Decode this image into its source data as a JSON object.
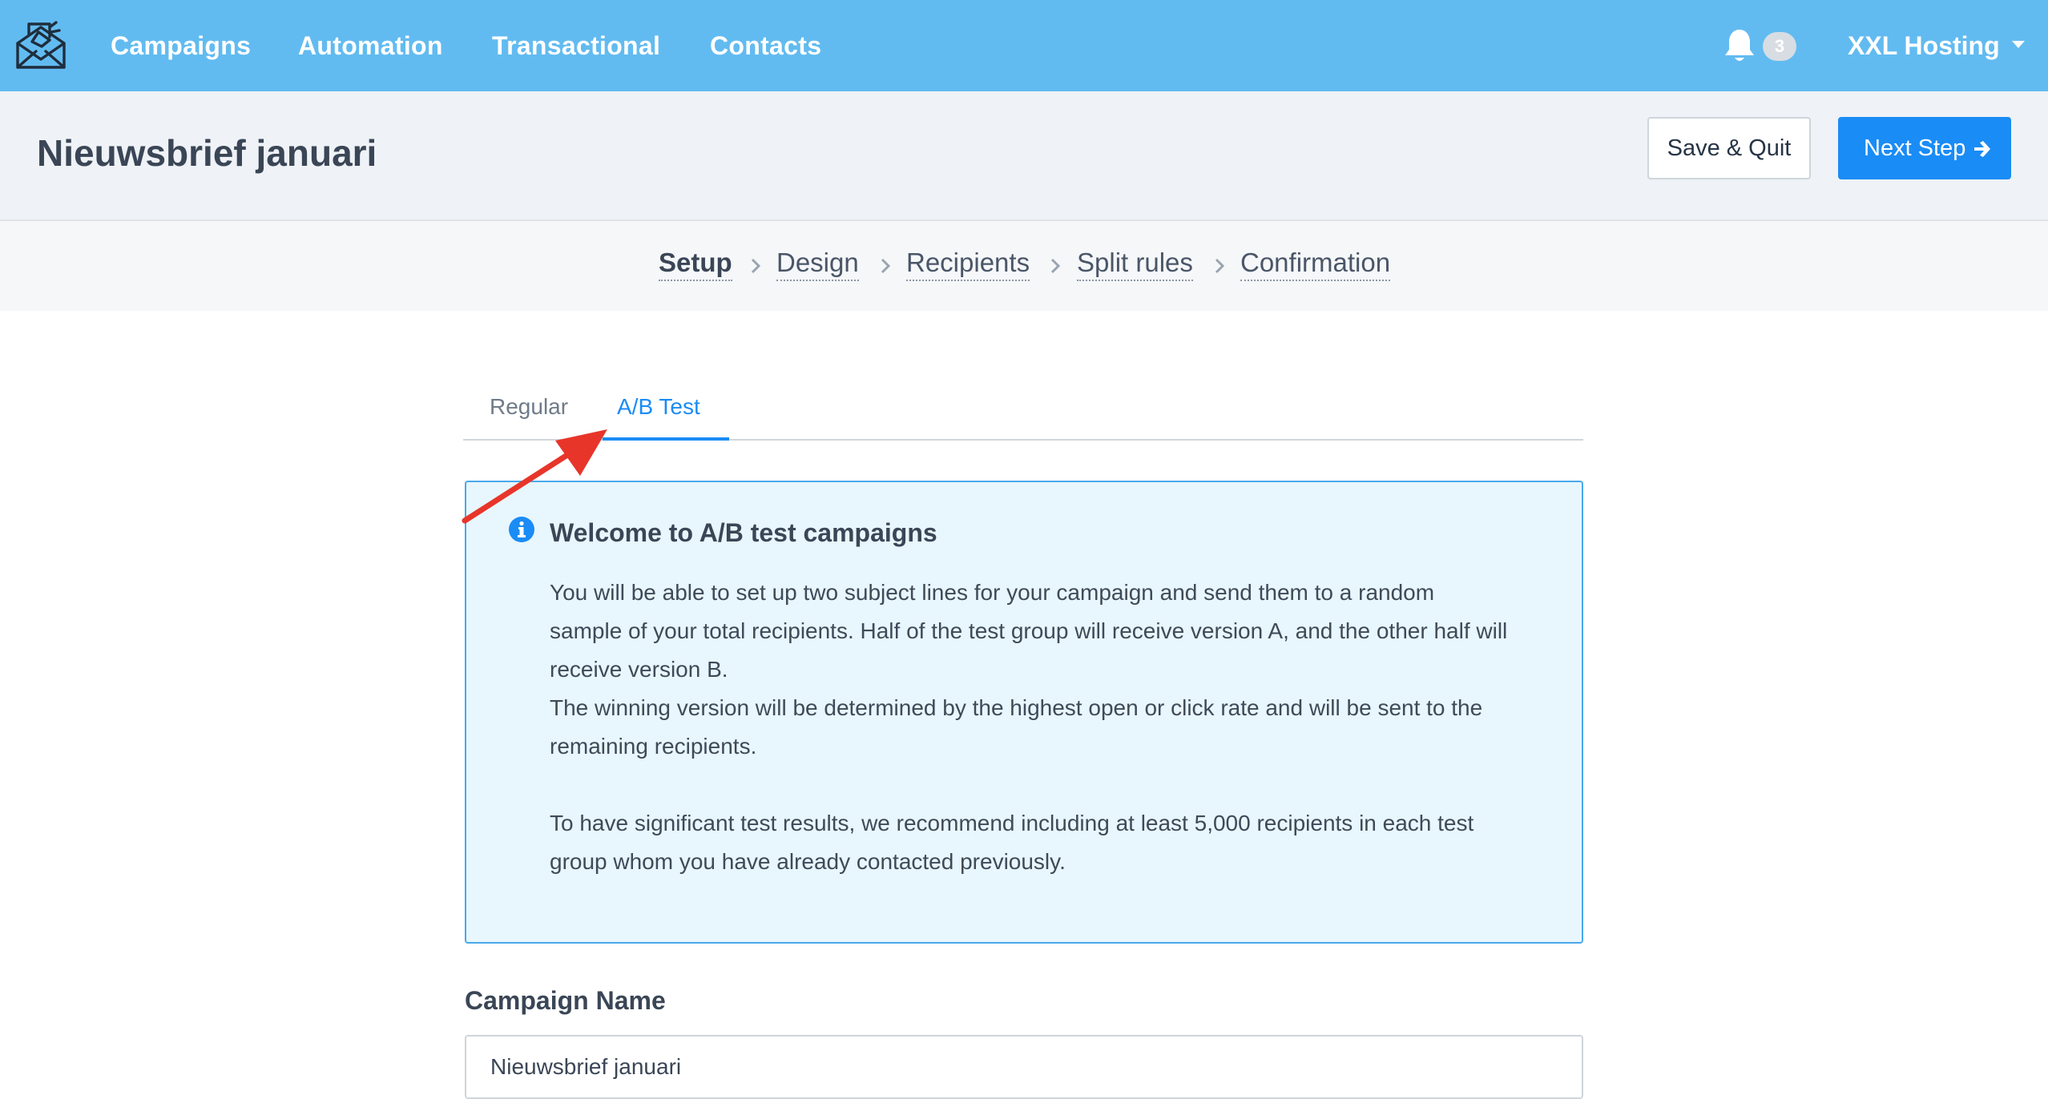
{
  "nav": {
    "items": [
      {
        "label": "Campaigns"
      },
      {
        "label": "Automation"
      },
      {
        "label": "Transactional"
      },
      {
        "label": "Contacts"
      }
    ],
    "notification_count": "3",
    "account_name": "XXL Hosting",
    "logo_icon": "envelope-megaphone-logo",
    "bell_icon": "bell-icon",
    "accent_color": "#62bbf0"
  },
  "header": {
    "title": "Nieuwsbrief januari",
    "save_quit_label": "Save & Quit",
    "next_step_label": "Next Step",
    "primary_color": "#1a8cf5"
  },
  "steps": [
    {
      "label": "Setup",
      "active": true
    },
    {
      "label": "Design"
    },
    {
      "label": "Recipients"
    },
    {
      "label": "Split rules"
    },
    {
      "label": "Confirmation"
    }
  ],
  "tabs": [
    {
      "label": "Regular",
      "active": false
    },
    {
      "label": "A/B Test",
      "active": true
    }
  ],
  "info": {
    "title": "Welcome to A/B test campaigns",
    "line1": "You will be able to set up two subject lines for your campaign and send them to a random sample of your total recipients. Half of the test group will receive version A, and the other half will receive version B.",
    "line2": "The winning version will be determined by the highest open or click rate and will be sent to the remaining recipients.",
    "line3": "To have significant test results, we recommend including at least 5,000 recipients in each test group whom you have already contacted previously.",
    "border_color": "#4aa8ec",
    "background_color": "#e8f6fd"
  },
  "form": {
    "campaign_name_label": "Campaign Name",
    "campaign_name_value": "Nieuwsbrief januari"
  },
  "annotation": {
    "arrow_color": "#e8352a"
  }
}
